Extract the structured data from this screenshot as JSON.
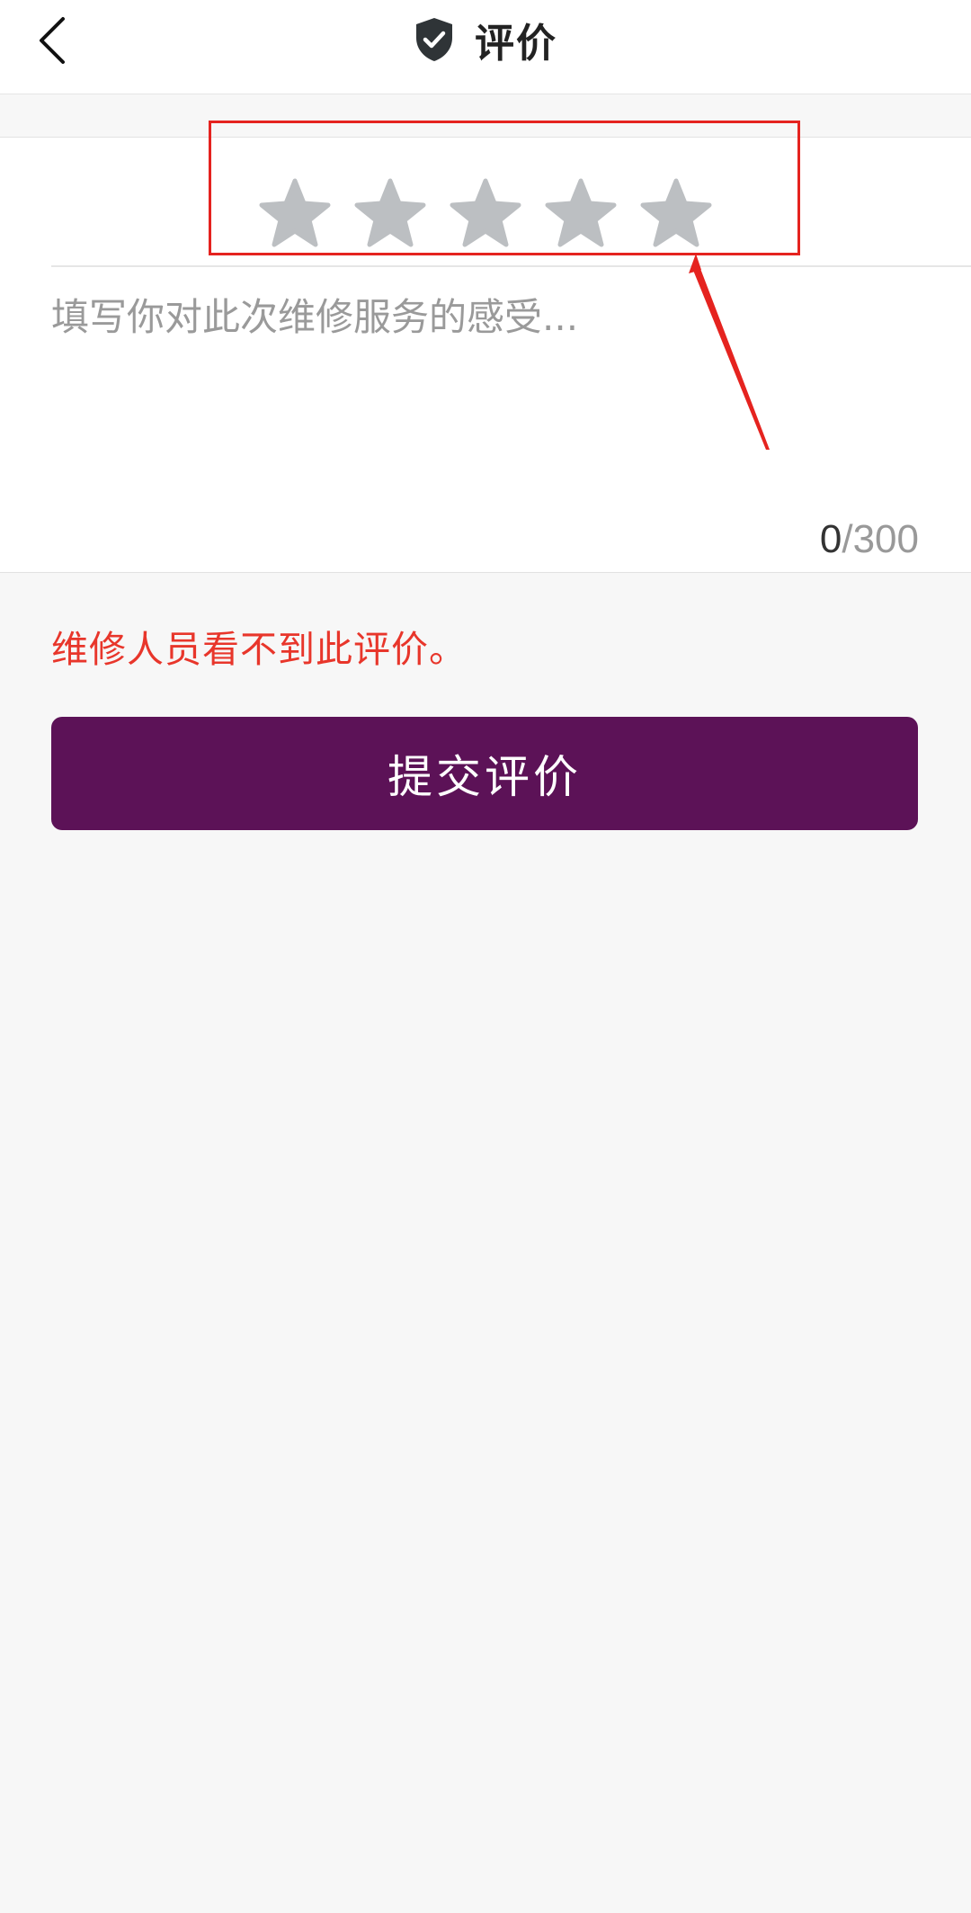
{
  "header": {
    "title": "评价",
    "back_icon": "chevron-left-icon",
    "title_icon": "shield-check-icon"
  },
  "rating": {
    "max_stars": 5,
    "selected": 0,
    "star_color": "#bcbfc2"
  },
  "comment": {
    "placeholder": "填写你对此次维修服务的感受...",
    "value": "",
    "count_current": "0",
    "count_separator": "/",
    "count_max": "300"
  },
  "notice": {
    "text": "维修人员看不到此评价。",
    "color": "#e8362b"
  },
  "submit": {
    "label": "提交评价",
    "color": "#5c1257"
  },
  "annotation": {
    "color": "#e5231f"
  }
}
